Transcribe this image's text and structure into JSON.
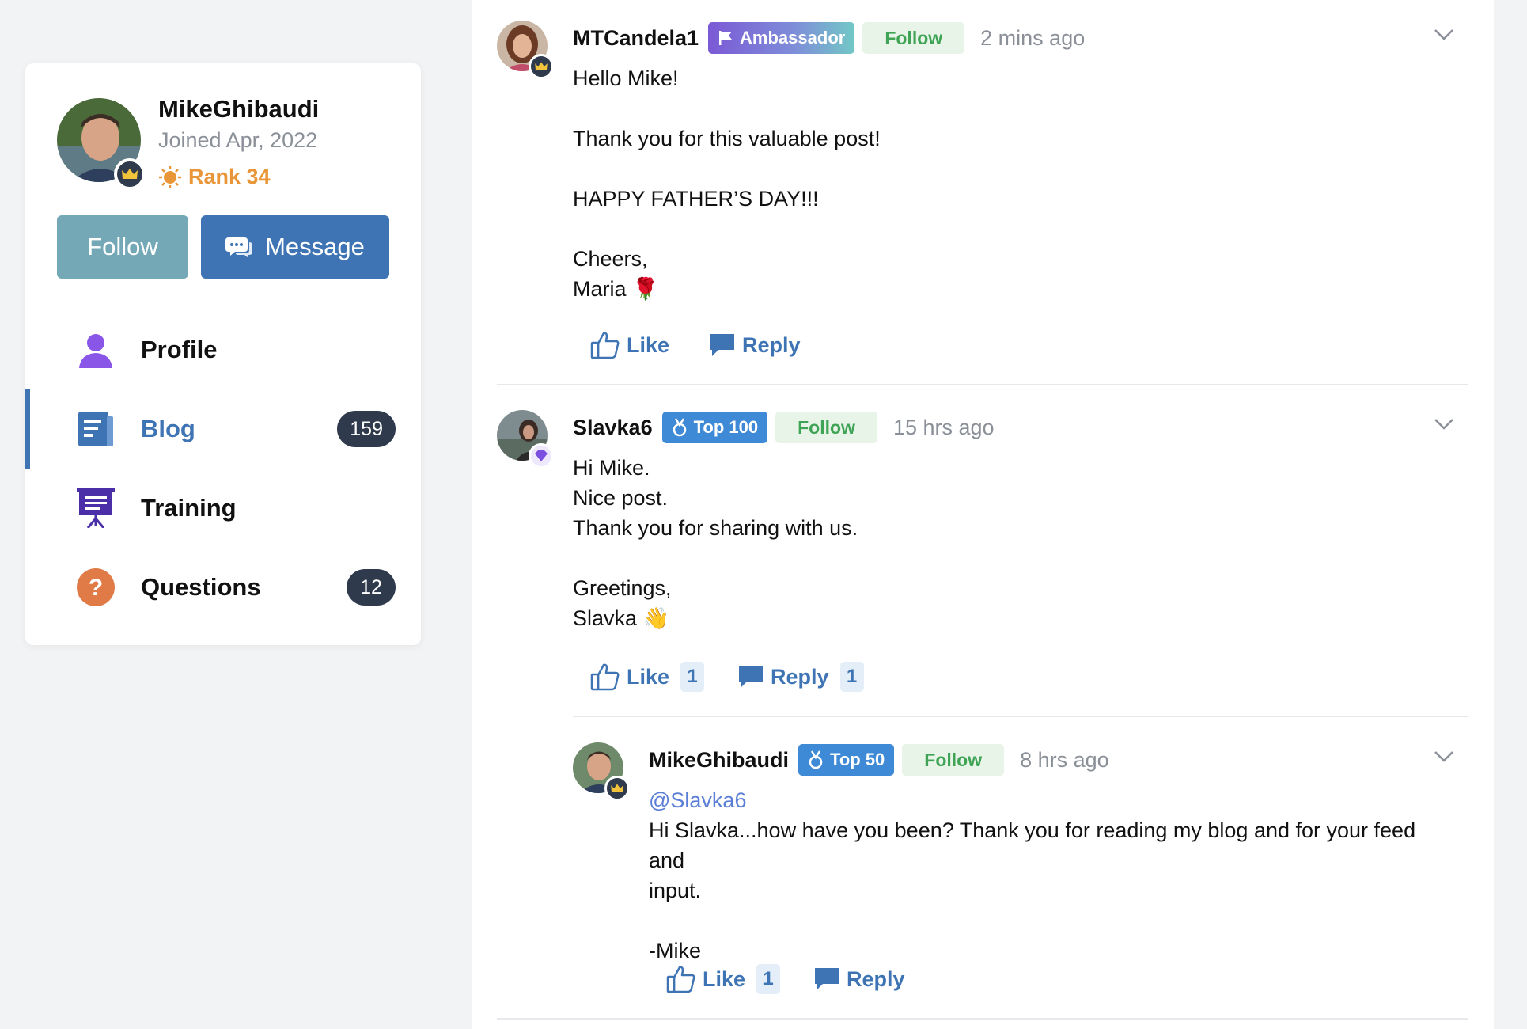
{
  "sidebar": {
    "user_name": "MikeGhibaudi",
    "joined": "Joined Apr, 2022",
    "rank": "Rank 34",
    "follow_label": "Follow",
    "message_label": "Message",
    "nav": [
      {
        "label": "Profile",
        "count": null
      },
      {
        "label": "Blog",
        "count": "159"
      },
      {
        "label": "Training",
        "count": null
      },
      {
        "label": "Questions",
        "count": "12"
      }
    ]
  },
  "comments": [
    {
      "user": "MTCandela1",
      "tag": "Ambassador",
      "follow": "Follow",
      "time": "2 mins ago",
      "body": [
        "Hello Mike!",
        "",
        "Thank you for this valuable post!",
        "",
        "HAPPY FATHER’S DAY!!!",
        "",
        "Cheers,",
        "Maria 🌹"
      ],
      "like_label": "Like",
      "reply_label": "Reply"
    },
    {
      "user": "Slavka6",
      "tag": "Top 100",
      "follow": "Follow",
      "time": "15 hrs ago",
      "body": [
        "Hi Mike.",
        "Nice post.",
        "Thank you for sharing with us.",
        "",
        "Greetings,",
        "Slavka 👋"
      ],
      "like_label": "Like",
      "like_count": "1",
      "reply_label": "Reply",
      "reply_count": "1"
    },
    {
      "user": "MikeGhibaudi",
      "tag": "Top 50",
      "follow": "Follow",
      "time": "8 hrs ago",
      "mention": "@Slavka6",
      "body": [
        "Hi Slavka...how have you been? Thank you for reading my blog and for your feed and",
        "input.",
        "",
        "-Mike"
      ],
      "like_label": "Like",
      "like_count": "1",
      "reply_label": "Reply"
    }
  ],
  "colors": {
    "accent": "#3e74b4",
    "follow_green": "#3fa455",
    "rank_orange": "#e89637",
    "badge_dark": "#2f3b4c"
  },
  "icons": [
    "crown-icon",
    "sun-rank-icon",
    "chat-bubbles-icon",
    "person-icon",
    "document-icon",
    "presentation-icon",
    "question-icon",
    "flag-icon",
    "medal-icon",
    "gem-icon",
    "thumbs-up-icon",
    "reply-bubble-icon",
    "chevron-down-icon"
  ]
}
